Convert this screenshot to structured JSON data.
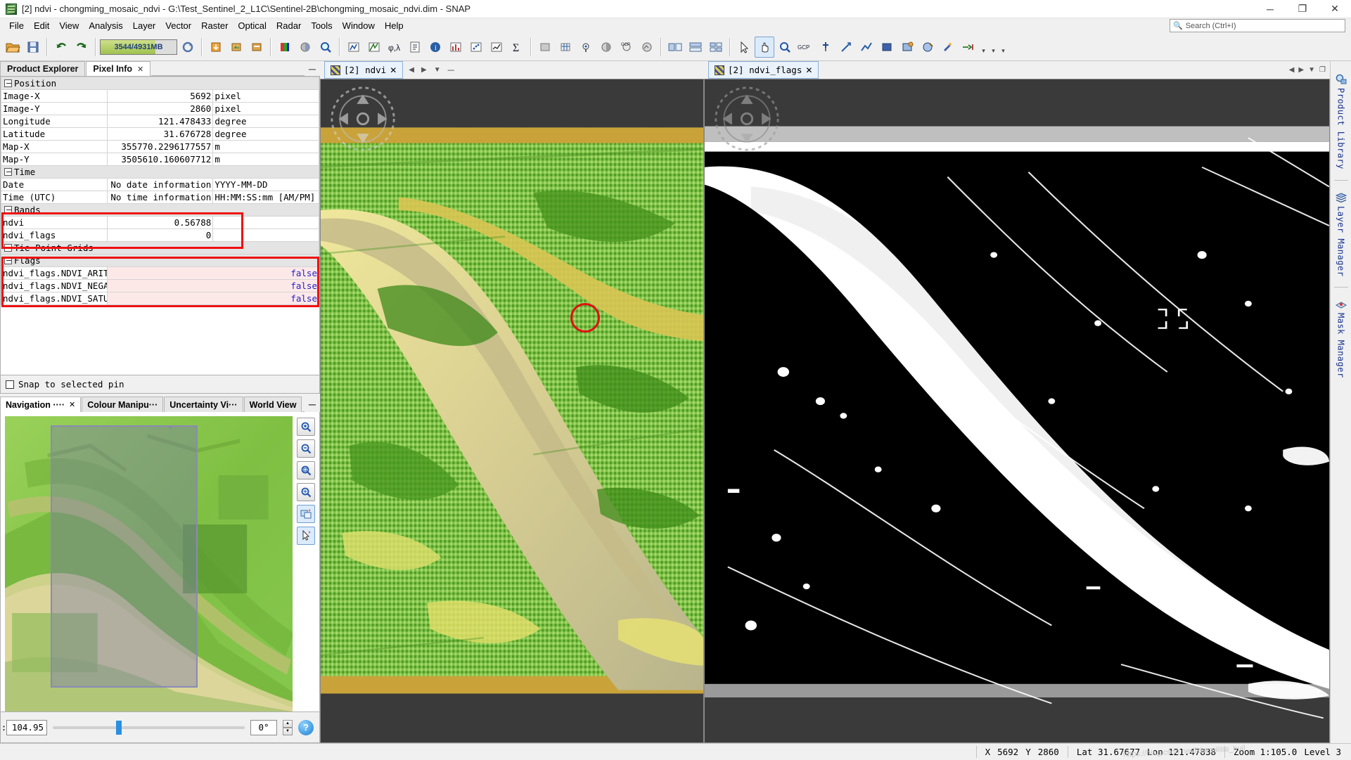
{
  "window": {
    "title": "[2] ndvi - chongming_mosaic_ndvi - G:\\Test_Sentinel_2_L1C\\Sentinel-2B\\chongming_mosaic_ndvi.dim - SNAP",
    "minimize": "─",
    "maximize": "❐",
    "close": "✕"
  },
  "menu": {
    "items": [
      "File",
      "Edit",
      "View",
      "Analysis",
      "Layer",
      "Vector",
      "Raster",
      "Optical",
      "Radar",
      "Tools",
      "Window",
      "Help"
    ],
    "search_placeholder": "Search (Ctrl+I)",
    "search_icon": "search-icon"
  },
  "toolbar": {
    "memory_text": "3544/4931MB",
    "memory_fraction": 0.72
  },
  "left_panel": {
    "tabs": [
      {
        "label": "Product Explorer",
        "active": false,
        "closable": false
      },
      {
        "label": "Pixel Info",
        "active": true,
        "closable": true
      }
    ],
    "minimize": "─",
    "pixel_info": {
      "groups": [
        {
          "name": "Position",
          "rows": [
            {
              "key": "Image-X",
              "value": "5692",
              "unit": "pixel"
            },
            {
              "key": "Image-Y",
              "value": "2860",
              "unit": "pixel"
            },
            {
              "key": "Longitude",
              "value": "121.478433",
              "unit": "degree"
            },
            {
              "key": "Latitude",
              "value": "31.676728",
              "unit": "degree"
            },
            {
              "key": "Map-X",
              "value": "355770.2296177557",
              "unit": "m"
            },
            {
              "key": "Map-Y",
              "value": "3505610.160607712",
              "unit": "m"
            }
          ]
        },
        {
          "name": "Time",
          "rows": [
            {
              "key": "Date",
              "value": "No date information",
              "unit": "YYYY-MM-DD"
            },
            {
              "key": "Time (UTC)",
              "value": "No time information",
              "unit": "HH:MM:SS:mm  [AM/PM]"
            }
          ]
        },
        {
          "name": "Bands",
          "rows": [
            {
              "key": "ndvi",
              "value": "0.56788",
              "unit": ""
            },
            {
              "key": "ndvi_flags",
              "value": "0",
              "unit": ""
            }
          ]
        },
        {
          "name": "Tie-Point Grids",
          "rows": []
        },
        {
          "name": "Flags",
          "rows": [
            {
              "key": "ndvi_flags.NDVI_ARITHMETIC",
              "value": "false",
              "unit": ""
            },
            {
              "key": "ndvi_flags.NDVI_NEGATIVE",
              "value": "false",
              "unit": ""
            },
            {
              "key": "ndvi_flags.NDVI_SATURATION",
              "value": "false",
              "unit": ""
            }
          ]
        }
      ]
    },
    "snap_checkbox_label": "Snap to selected pin",
    "nav_tabs": [
      {
        "label": "Navigation ····",
        "active": true,
        "closable": true
      },
      {
        "label": "Colour Manipu···",
        "active": false,
        "closable": false
      },
      {
        "label": "Uncertainty Vi···",
        "active": false,
        "closable": false
      },
      {
        "label": "World View",
        "active": false,
        "closable": false
      }
    ],
    "nav_minimize": "─",
    "nav_tools": [
      {
        "name": "zoom-in-icon",
        "glyph": "+"
      },
      {
        "name": "zoom-out-icon",
        "glyph": "−"
      },
      {
        "name": "zoom-to-pixel-icon",
        "glyph": "□"
      },
      {
        "name": "zoom-all-icon",
        "glyph": "⌖"
      },
      {
        "name": "sync-views-icon",
        "glyph": "⧉"
      },
      {
        "name": "sync-cursor-icon",
        "glyph": "↖"
      }
    ],
    "zoom_value": "104.95",
    "zoom_prefix": ":",
    "rotation_value": "0°",
    "help_label": "?"
  },
  "views": {
    "left_view": {
      "tab_label": "[2] ndvi",
      "close": "✕",
      "minimize": "─",
      "nav_prev": "◀",
      "nav_next": "▶",
      "dropdown": "▼",
      "float": "❐"
    },
    "right_view": {
      "tab_label": "[2] ndvi_flags",
      "close": "✕",
      "nav_prev": "◀",
      "nav_next": "▶",
      "dropdown": "▼",
      "float": "❐"
    }
  },
  "right_dock": {
    "items": [
      {
        "label": "Product Library",
        "icon": "product-library-icon"
      },
      {
        "label": "Layer Manager",
        "icon": "layer-manager-icon"
      },
      {
        "label": "Mask Manager",
        "icon": "mask-manager-icon"
      }
    ]
  },
  "status_bar": {
    "x_label": "X",
    "x_value": "5692",
    "y_label": "Y",
    "y_value": "2860",
    "lat": "Lat 31.67677",
    "lon": "Lon 121.47838",
    "zoom": "Zoom 1:105.0",
    "level": "Level 3",
    "watermark": "https://blog.csdn.net/lidarmilitia_huil"
  }
}
